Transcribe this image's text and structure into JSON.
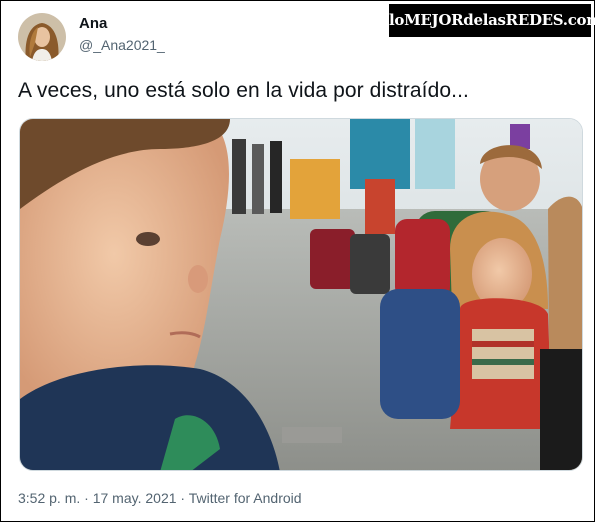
{
  "author": {
    "display_name": "Ana",
    "handle": "@_Ana2021_"
  },
  "watermark": "loMEJORdelasREDES.com",
  "tweet": {
    "text": "A veces, uno está solo en la vida por distraído..."
  },
  "meta": {
    "time": "3:52 p. m.",
    "date": "17 may. 2021",
    "source": "Twitter for Android",
    "separator": " · "
  },
  "colors": {
    "text": "#0f1419",
    "secondary": "#536471",
    "watermark_bg": "#000000"
  }
}
